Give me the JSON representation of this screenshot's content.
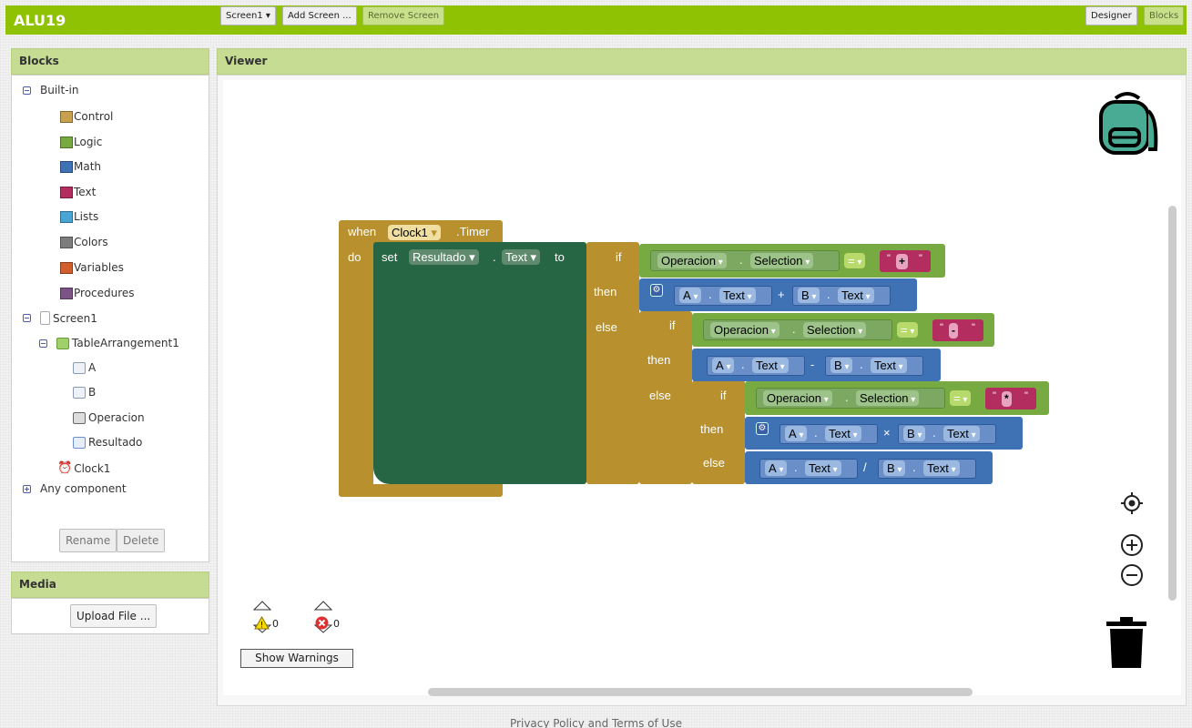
{
  "app": {
    "title": "ALU19"
  },
  "toolbar": {
    "screen_select": "Screen1 ▾",
    "add_screen": "Add Screen ...",
    "remove_screen": "Remove Screen",
    "designer": "Designer",
    "blocks": "Blocks"
  },
  "blocks_panel": {
    "title": "Blocks",
    "builtin_label": "Built-in",
    "builtin": [
      {
        "label": "Control",
        "color": "#c8a04e"
      },
      {
        "label": "Logic",
        "color": "#77ab41"
      },
      {
        "label": "Math",
        "color": "#3f71b5"
      },
      {
        "label": "Text",
        "color": "#b32d5e"
      },
      {
        "label": "Lists",
        "color": "#49a6d4"
      },
      {
        "label": "Colors",
        "color": "#7d7d7d"
      },
      {
        "label": "Variables",
        "color": "#d05f2d"
      },
      {
        "label": "Procedures",
        "color": "#7c5385"
      }
    ],
    "screen_label": "Screen1",
    "table_label": "TableArrangement1",
    "components": [
      "A",
      "B",
      "Operacion",
      "Resultado"
    ],
    "clock_label": "Clock1",
    "any_component": "Any component",
    "rename": "Rename",
    "delete": "Delete"
  },
  "media": {
    "title": "Media",
    "upload": "Upload File ..."
  },
  "viewer": {
    "title": "Viewer"
  },
  "workspace": {
    "when": "when",
    "clock": "Clock1",
    "timer": ".Timer",
    "do": "do",
    "set": "set",
    "resultado": "Resultado",
    "text_prop": "Text",
    "to": "to",
    "if": "if",
    "then": "then",
    "else": "else",
    "operacion": "Operacion",
    "selection": "Selection",
    "eq": "=",
    "dot": ".",
    "a": "A",
    "b": "B",
    "ops": [
      "+",
      "-",
      "*"
    ],
    "math_ops": [
      "+",
      "-",
      "×",
      "/"
    ],
    "quote": "\""
  },
  "warnings": {
    "warn_count": "0",
    "error_count": "0",
    "show_warnings": "Show Warnings"
  },
  "footer": {
    "text": "Privacy Policy and Terms of Use"
  }
}
